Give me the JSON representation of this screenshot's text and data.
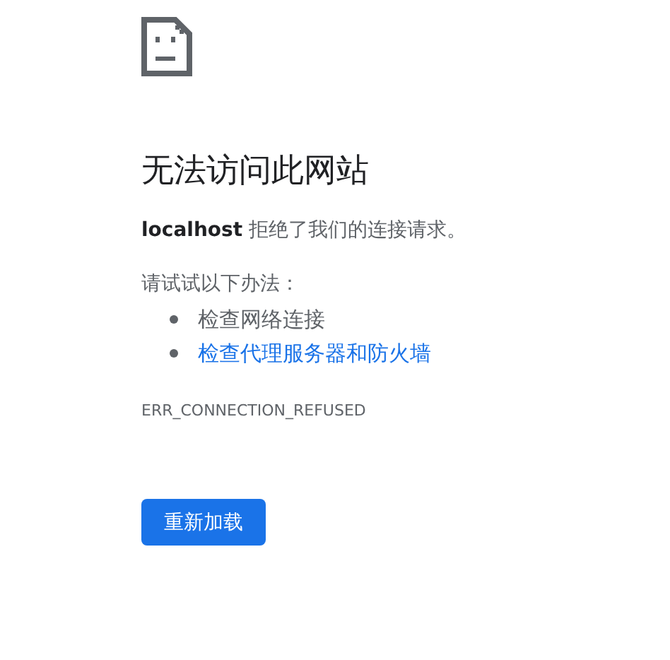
{
  "heading": "无法访问此网站",
  "message": "**localhost** 拒绝了我们的连接请求。",
  "suggestions_intro": "请试试以下办法：",
  "suggestions": [
    {
      "label": "检查网络连接",
      "kind": "text"
    },
    {
      "label": "检查代理服务器和防火墙",
      "kind": "link"
    }
  ],
  "error_code": "ERR_CONNECTION_REFUSED",
  "reload_button": "重新加载"
}
